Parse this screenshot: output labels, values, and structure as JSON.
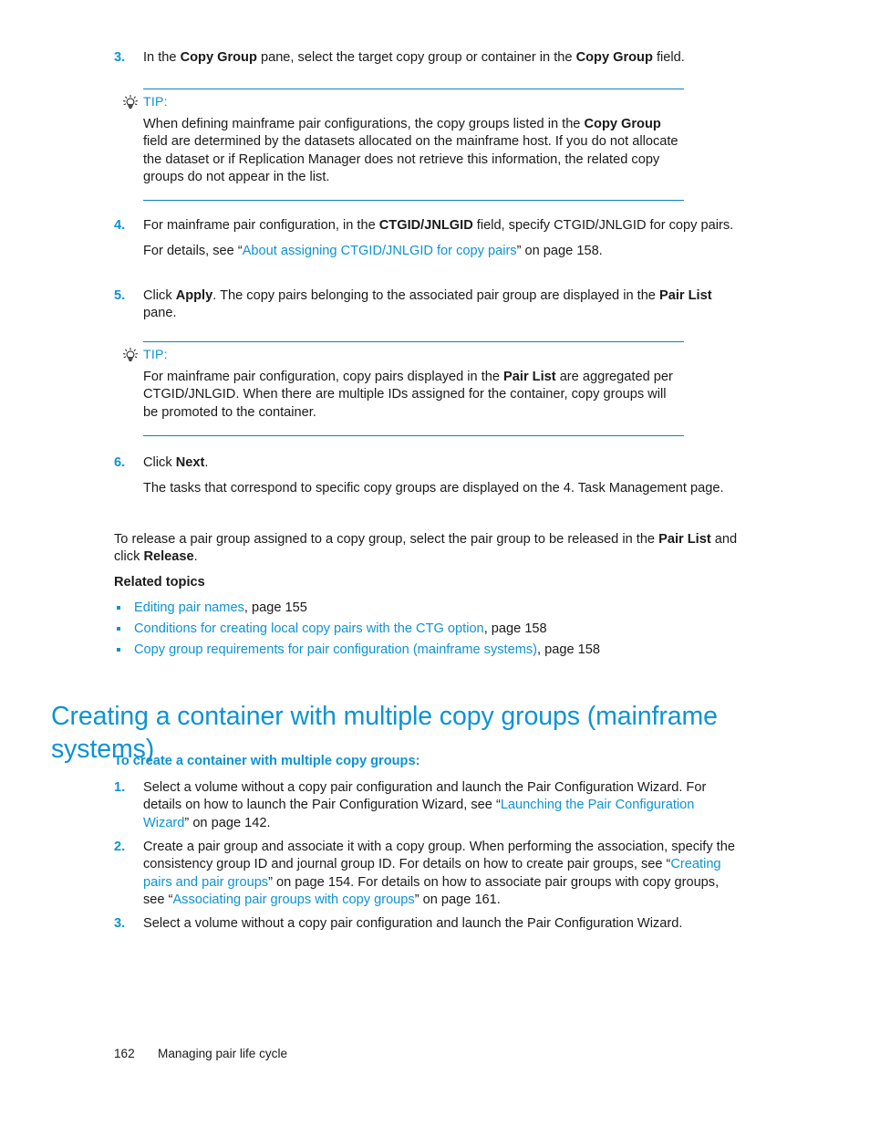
{
  "document": {
    "footer": {
      "page_number": "162",
      "section": "Managing pair life cycle"
    }
  },
  "steps_group_1": {
    "step3": {
      "number": "3.",
      "text_part1": "In the ",
      "bold1": "Copy Group",
      "text_part2": " pane, select the target copy group or container in the ",
      "bold2": "Copy Group",
      "text_part3": " field."
    },
    "step4": {
      "number": "4.",
      "text_part1": "For mainframe pair configuration, in the ",
      "bold1": "CTGID/JNLGID",
      "text_part2": " field, specify CTGID/JNLGID for copy pairs.",
      "cont_part1": "For details, see “",
      "link": "About assigning CTGID/JNLGID for copy pairs",
      "cont_part2": "” on page 158."
    },
    "step5": {
      "number": "5.",
      "text_part1": "Click ",
      "bold1": "Apply",
      "text_part2": ". The copy pairs belonging to the associated pair group are displayed in the ",
      "bold2": "Pair List",
      "text_part3": " pane."
    },
    "step6": {
      "number": "6.",
      "text_part1": "Click ",
      "bold1": "Next",
      "text_part2": ".",
      "cont": "The tasks that correspond to specific copy groups are displayed on the 4. Task Management page."
    }
  },
  "tip1": {
    "icon": "lightbulb-icon",
    "label": "TIP:",
    "body_part1": "When defining mainframe pair configurations, the copy groups listed in the ",
    "body_bold1": "Copy Group",
    "body_part2": " field are determined by the datasets allocated on the mainframe host. If you do not allocate the dataset or if Replication Manager does not retrieve this information, the related copy groups do not appear in the list."
  },
  "tip2": {
    "icon": "lightbulb-icon",
    "label": "TIP:",
    "body_part1": "For mainframe pair configuration, copy pairs displayed in the ",
    "body_bold1": "Pair List",
    "body_part2": " are aggregated per CTGID/JNLGID. When there are multiple IDs assigned for the container, copy groups will be promoted to the container."
  },
  "release_paragraph": {
    "part1": "To release a pair group assigned to a copy group, select the pair group to be released in the ",
    "bold1": "Pair List",
    "part2": " and click ",
    "bold2": "Release",
    "part3": "."
  },
  "related_topics": {
    "heading": "Related topics",
    "items": [
      {
        "link": "Editing pair names",
        "suffix": ", page 155"
      },
      {
        "link": "Conditions for creating local copy pairs with the CTG option",
        "suffix": ", page 158"
      },
      {
        "link": "Copy group requirements for pair configuration (mainframe systems)",
        "suffix": ", page 158"
      }
    ]
  },
  "section": {
    "heading": "Creating a container with multiple copy groups (mainframe systems)",
    "subheading": "To create a container with multiple copy groups:",
    "step1": {
      "number": "1.",
      "text_part1": "Select a volume without a copy pair configuration and launch the Pair Configuration Wizard. For details on how to launch the Pair Configuration Wizard, see “",
      "link": "Launching the Pair Configuration Wizard",
      "text_part2": "” on page 142."
    },
    "step2": {
      "number": "2.",
      "text_part1": "Create a pair group and associate it with a copy group. When performing the association, specify the consistency group ID and journal group ID. For details on how to create pair groups, see “",
      "link1": "Creating pairs and pair groups",
      "text_part2": "” on page 154. For details on how to associate pair groups with copy groups, see “",
      "link2": "Associating pair groups with copy groups",
      "text_part3": "” on page 161."
    },
    "step3": {
      "number": "3.",
      "text": "Select a volume without a copy pair configuration and launch the Pair Configuration Wizard."
    }
  },
  "colors": {
    "accent_blue": "#0d93d2",
    "rule_blue": "#0d81c4",
    "body_text": "#1a1a1a"
  }
}
